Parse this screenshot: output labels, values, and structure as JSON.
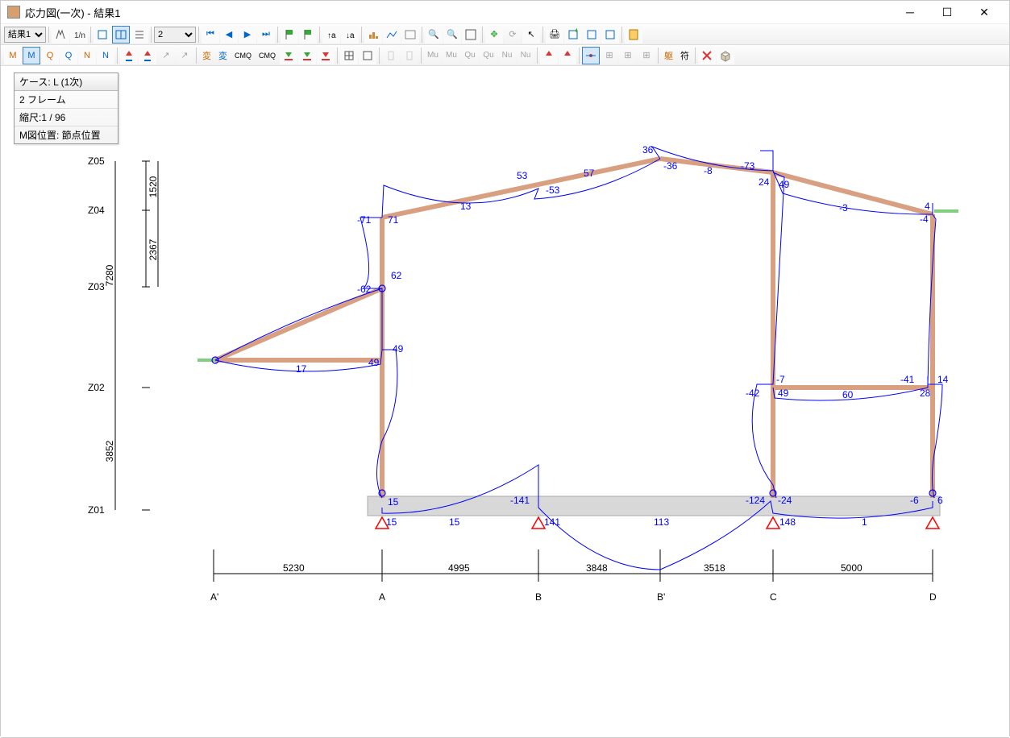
{
  "window": {
    "title": "応力図(一次) - 結果1"
  },
  "toolbar1": {
    "resultSelect": "結果1",
    "viewSelect": "2"
  },
  "toolbar2": {
    "items": [
      "M",
      "M",
      "Q",
      "Q",
      "N",
      "N"
    ],
    "textBtns": [
      "変",
      "変",
      "CMQ",
      "CMQ"
    ],
    "tail": [
      "Mu",
      "Mu",
      "Qu",
      "Qu",
      "Nu",
      "Nu"
    ],
    "end": [
      "躯",
      "符"
    ]
  },
  "info": {
    "r1": "ケース: L (1次)",
    "r2": "2 フレーム",
    "r3": "縮尺:1 / 96",
    "r4": "M図位置:   節点位置"
  },
  "axes": {
    "z": [
      "Z05",
      "Z04",
      "Z03",
      "Z02",
      "Z01"
    ],
    "x": [
      "A'",
      "A",
      "B",
      "B'",
      "C",
      "D"
    ],
    "xDims": [
      "5230",
      "4995",
      "3848",
      "3518",
      "5000"
    ],
    "zDimsRight": [
      "1520",
      "2367"
    ],
    "zDimLeft": "7280",
    "zDimLeft2": "3852"
  },
  "values": {
    "topRoof": {
      "v36": "36",
      "vn36": "-36",
      "v53": "53",
      "vn53": "-53",
      "v57": "57",
      "vn8": "-8",
      "v13": "13",
      "vn73": "-73",
      "v24": "24",
      "v49": "49",
      "vn3": "-3",
      "v4": "4",
      "vn4": "-4"
    },
    "colB": {
      "vn71": "-71",
      "v71": "71",
      "v62": "62",
      "vn62": "-62",
      "v49a": "49",
      "vn49": "-49",
      "v17": "17"
    },
    "midBeam": {
      "vn7": "-7",
      "vn42": "-42",
      "v49b": "49",
      "v60": "60",
      "vn41": "-41",
      "v28": "28",
      "v14": "14"
    },
    "foundation": {
      "v15a": "15",
      "vn141": "-141",
      "vn124": "-124",
      "vn24": "-24",
      "vn6": "-6",
      "v6": "6",
      "v15b": "15",
      "v15c": "15",
      "v141": "141",
      "v113": "113",
      "v148": "148",
      "v1": "1"
    }
  }
}
